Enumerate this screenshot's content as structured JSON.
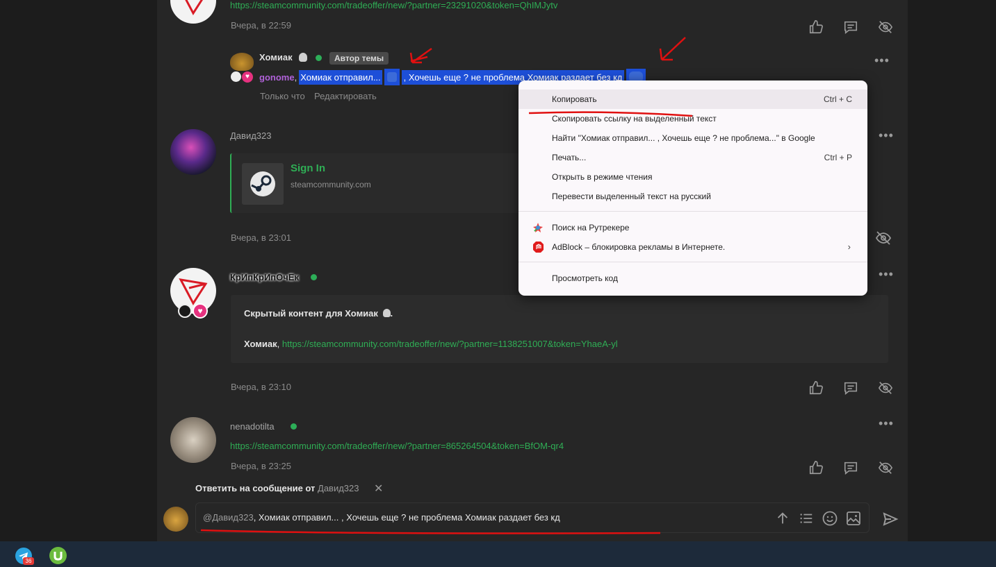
{
  "colors": {
    "accent_green": "#2fae55",
    "selection": "#1d4fd8",
    "annotation_red": "#e01010",
    "badge_pink": "#e6317f"
  },
  "post1": {
    "link": "https://steamcommunity.com/tradeoffer/new/?partner=23291020&token=QhIMJytv",
    "time": "Вчера, в 22:59"
  },
  "reply_comment": {
    "author": "Хомиак",
    "author_badge": "Автор темы",
    "mention": "gonome",
    "text_part1": "Хомиак отправил...",
    "text_part2": ", Хочешь еще ? не проблема Хомиак раздает без кд",
    "time": "Только что",
    "edit_label": "Редактировать"
  },
  "post2": {
    "author": "Давид323",
    "embed_title": "Sign In",
    "embed_domain": "steamcommunity.com",
    "time": "Вчера, в 23:01"
  },
  "post3": {
    "author": "КрИпКрИпОчЕк",
    "hidden_label": "Скрытый контент для",
    "hidden_user": "Хомиак",
    "hidden_end": ".",
    "mention": "Хомиак",
    "link": "https://steamcommunity.com/tradeoffer/new/?partner=1138251007&token=YhaeA-yl",
    "time": "Вчера, в 23:10"
  },
  "post4": {
    "author": "nenadotilta",
    "link": "https://steamcommunity.com/tradeoffer/new/?partner=865264504&token=BfOM-qr4",
    "time": "Вчера, в 23:25"
  },
  "reply_bar": {
    "label": "Ответить на сообщение от",
    "target": "Давид323"
  },
  "composer": {
    "mention": "@Давид323",
    "text": ", Хомиак отправил...  , Хочешь еще ? не проблема Хомиак раздает без кд"
  },
  "context_menu": {
    "copy": "Копировать",
    "copy_shortcut": "Ctrl + C",
    "copy_link": "Скопировать ссылку на выделенный текст",
    "search_google": "Найти \"Хомиак отправил...  , Хочешь еще ? не проблема...\" в Google",
    "print": "Печать...",
    "print_shortcut": "Ctrl + P",
    "reader_mode": "Открыть в режиме чтения",
    "translate": "Перевести выделенный текст на русский",
    "rutracker": "Поиск на Рутрекере",
    "adblock": "AdBlock – блокировка рекламы в Интернете.",
    "inspect": "Просмотреть код"
  },
  "taskbar": {
    "telegram_badge": "36"
  },
  "icons": [
    "like-icon",
    "comment-icon",
    "hide-icon",
    "more-icon",
    "close-icon",
    "send-icon",
    "upload-icon",
    "list-icon",
    "emoji-icon",
    "image-icon",
    "steam-icon",
    "telegram-icon",
    "utorrent-icon",
    "rutracker-icon",
    "adblock-icon",
    "chevron-right-icon"
  ]
}
